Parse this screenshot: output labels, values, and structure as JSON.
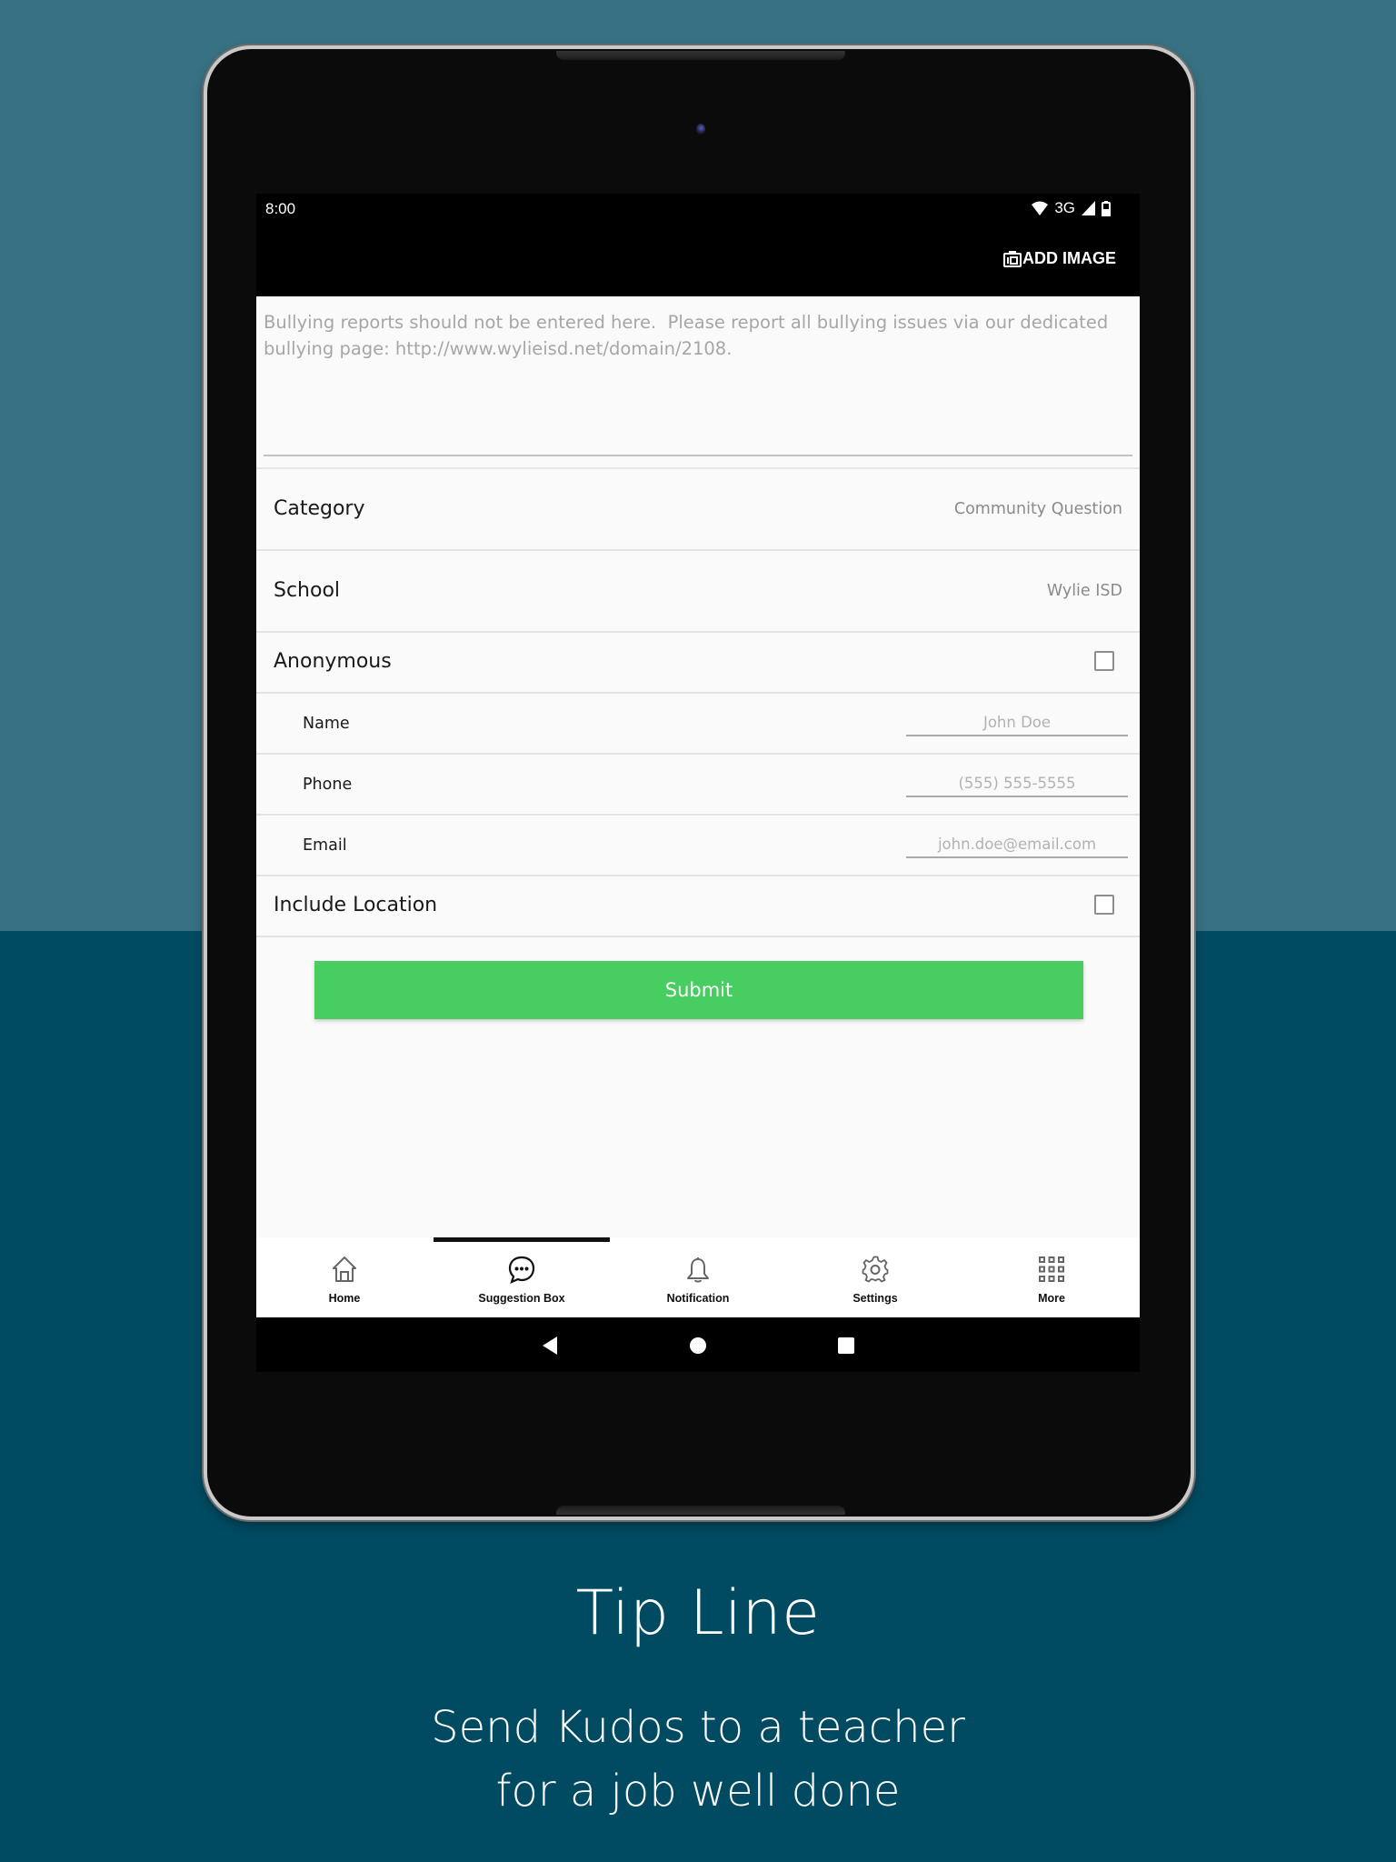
{
  "status_bar": {
    "time": "8:00",
    "network": "3G",
    "icons": [
      "wifi-icon",
      "cellular-signal-icon",
      "battery-icon"
    ]
  },
  "app_bar": {
    "add_image_label": "ADD IMAGE",
    "add_image_icon": "camera-icon"
  },
  "form": {
    "message_placeholder": "Bullying reports should not be entered here.  Please report all bullying issues via our dedicated bullying page: http://www.wylieisd.net/domain/2108.",
    "message_value": "",
    "category": {
      "label": "Category",
      "value": "Community Question"
    },
    "school": {
      "label": "School",
      "value": "Wylie ISD"
    },
    "anonymous": {
      "label": "Anonymous",
      "checked": false
    },
    "name": {
      "label": "Name",
      "placeholder": "John Doe",
      "value": ""
    },
    "phone": {
      "label": "Phone",
      "placeholder": "(555) 555-5555",
      "value": ""
    },
    "email": {
      "label": "Email",
      "placeholder": "john.doe@email.com",
      "value": ""
    },
    "include_location": {
      "label": "Include Location",
      "checked": false
    },
    "submit_label": "Submit",
    "submit_color": "#48cd60"
  },
  "bottom_nav": {
    "active_index": 1,
    "items": [
      {
        "label": "Home",
        "icon": "home-icon"
      },
      {
        "label": "Suggestion Box",
        "icon": "chat-bubble-icon"
      },
      {
        "label": "Notification",
        "icon": "bell-icon"
      },
      {
        "label": "Settings",
        "icon": "gear-icon"
      },
      {
        "label": "More",
        "icon": "grid-icon"
      }
    ]
  },
  "system_nav": {
    "buttons": [
      "back",
      "home",
      "recents"
    ]
  },
  "promo": {
    "title": "Tip Line",
    "subtitle": "Send Kudos to a teacher\n for a job well done"
  },
  "colors": {
    "background_top": "#387183",
    "background_bottom": "#004b62",
    "accent_green": "#48cd60"
  }
}
